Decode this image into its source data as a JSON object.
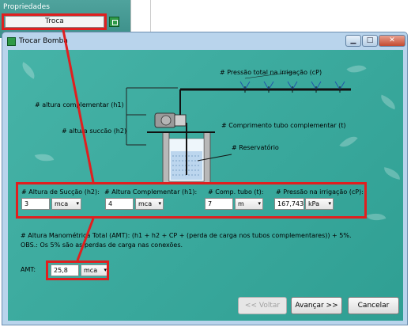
{
  "background": {
    "panel_title": "Propriedades",
    "troca_button": "Troca"
  },
  "window": {
    "title": "Trocar Bomba",
    "min_glyph": "▁",
    "max_glyph": "□",
    "close_glyph": "✕"
  },
  "diagram": {
    "pressao_total": "# Pressão total na irrigação (cP)",
    "altura_complementar": "# altura complementar (h1)",
    "altura_succao": "# altura succão (h2)",
    "comprimento_tubo": "# Comprimento tubo complementar (t)",
    "reservatorio": "# Reservatório"
  },
  "params": {
    "succao": {
      "label": "# Altura de Sucção (h2):",
      "value": "3",
      "unit": "mca"
    },
    "complementar": {
      "label": "# Altura Complementar (h1):",
      "value": "4",
      "unit": "mca"
    },
    "comp_tubo": {
      "label": "# Comp. tubo (t):",
      "value": "7",
      "unit": "m"
    },
    "pressao": {
      "label": "# Pressão na irrigação (cP):",
      "value": "167,743",
      "unit": "kPa"
    }
  },
  "amt": {
    "formula": "# Altura Manométrica Total (AMT): (h1 + h2 + CP + (perda de carga nos tubos complementares)) + 5%.",
    "obs": "OBS.: Os 5% são as perdas de carga nas conexões.",
    "label": "AMT:",
    "value": "25,8",
    "unit": "mca"
  },
  "buttons": {
    "back": "<< Voltar",
    "next": "Avançar >>",
    "cancel": "Cancelar"
  },
  "colors": {
    "content_bg": "#3aa89c",
    "highlight": "#e01f1f",
    "window_frame": "#b9d4ec"
  },
  "icons": {
    "dropdown": "▾"
  }
}
